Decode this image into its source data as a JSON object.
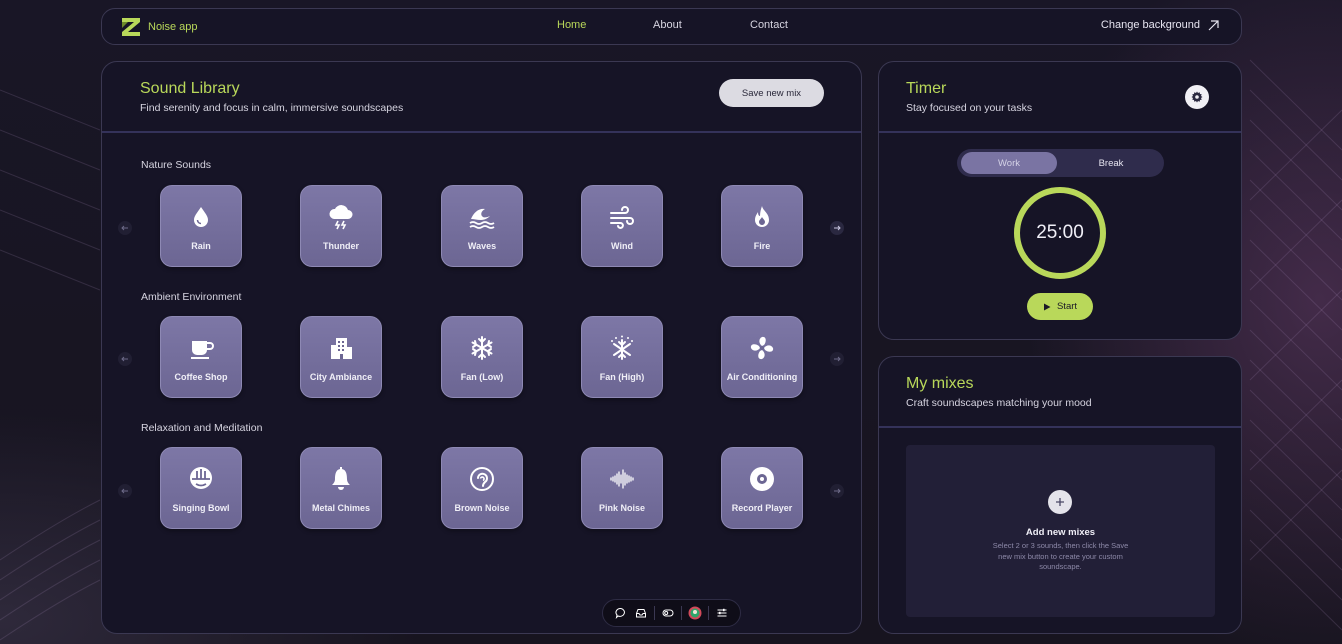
{
  "nav": {
    "app_name": "Noise app",
    "links": [
      "Home",
      "About",
      "Contact"
    ],
    "change_background": "Change background"
  },
  "library": {
    "title": "Sound Library",
    "subtitle": "Find serenity and focus in calm, immersive soundscapes",
    "save_button": "Save new mix",
    "sections": [
      {
        "label": "Nature Sounds",
        "items": [
          {
            "label": "Rain",
            "icon": "droplet-icon"
          },
          {
            "label": "Thunder",
            "icon": "cloud-bolt-icon"
          },
          {
            "label": "Waves",
            "icon": "water-wave-icon"
          },
          {
            "label": "Wind",
            "icon": "wind-icon"
          },
          {
            "label": "Fire",
            "icon": "fire-icon"
          }
        ]
      },
      {
        "label": "Ambient Environment",
        "items": [
          {
            "label": "Coffee Shop",
            "icon": "mug-icon"
          },
          {
            "label": "City Ambiance",
            "icon": "building-icon"
          },
          {
            "label": "Fan (Low)",
            "icon": "snowflake-icon"
          },
          {
            "label": "Fan (High)",
            "icon": "snowflake-burst-icon"
          },
          {
            "label": "Air Conditioning",
            "icon": "fan-icon"
          }
        ]
      },
      {
        "label": "Relaxation and Meditation",
        "items": [
          {
            "label": "Singing Bowl",
            "icon": "bowl-icon"
          },
          {
            "label": "Metal Chimes",
            "icon": "bell-icon"
          },
          {
            "label": "Brown Noise",
            "icon": "ear-icon"
          },
          {
            "label": "Pink Noise",
            "icon": "sound-wave-icon"
          },
          {
            "label": "Record Player",
            "icon": "record-icon"
          }
        ]
      }
    ]
  },
  "timer": {
    "title": "Timer",
    "subtitle": "Stay focused on your tasks",
    "modes": [
      "Work",
      "Break"
    ],
    "active_mode": "Work",
    "time": "25:00",
    "start_label": "Start",
    "progress": 1.0
  },
  "mixes": {
    "title": "My mixes",
    "subtitle": "Craft soundscapes matching your mood",
    "empty_title": "Add new mixes",
    "empty_desc": "Select 2 or 3 sounds, then click the Save new mix button to create your custom soundscape."
  },
  "colors": {
    "accent": "#b9d85a",
    "tile": "#7670a0",
    "panel": "#161426",
    "border": "#3b3852"
  }
}
